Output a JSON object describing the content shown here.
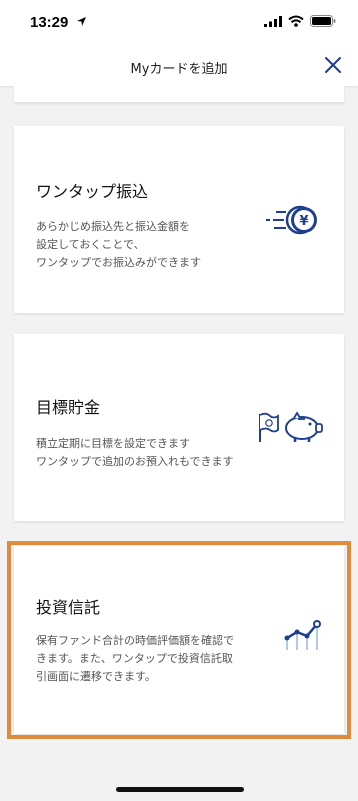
{
  "status_bar": {
    "time": "13:29"
  },
  "header": {
    "title": "Myカードを追加"
  },
  "cards": [
    {
      "title": "ワンタップ振込",
      "description": "あらかじめ振込先と振込金額を\n設定しておくことで、\nワンタップでお振込みができます",
      "icon": "yen-coin-transfer-icon"
    },
    {
      "title": "目標貯金",
      "description": "積立定期に目標を設定できます\nワンタップで追加のお預入れもできます",
      "icon": "flag-piggy-bank-icon"
    },
    {
      "title": "投資信託",
      "description": "保有ファンド合計の時価評価額を確認で\nきます。また、ワンタップで投資信託取\n引画面に遷移できます。",
      "icon": "investment-chart-icon"
    }
  ],
  "colors": {
    "accent": "#1e3f8f",
    "highlight": "#e08a3c"
  }
}
